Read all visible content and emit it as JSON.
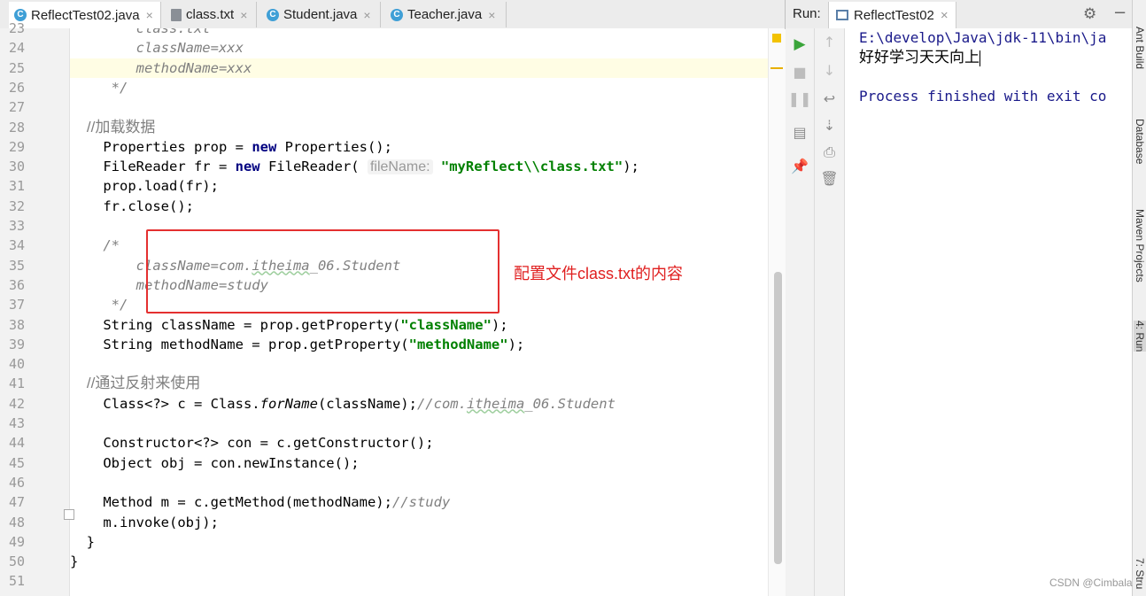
{
  "tabs": [
    {
      "label": "ReflectTest02.java",
      "icon": "java-class-icon",
      "active": true
    },
    {
      "label": "class.txt",
      "icon": "text-file-icon",
      "active": false
    },
    {
      "label": "Student.java",
      "icon": "java-class-icon",
      "active": false
    },
    {
      "label": "Teacher.java",
      "icon": "java-class-icon",
      "active": false
    }
  ],
  "tab_close_glyph": "×",
  "editor": {
    "lines": [
      {
        "n": "23",
        "text": "        class.txt"
      },
      {
        "n": "24",
        "text": "        className=xxx"
      },
      {
        "n": "25",
        "text": "        methodName=xxx"
      },
      {
        "n": "26",
        "text": "     */"
      },
      {
        "n": "27",
        "text": ""
      },
      {
        "n": "28",
        "text": "    //加载数据"
      },
      {
        "n": "29",
        "a": "    Properties prop = ",
        "b": "new",
        "c": " Properties();"
      },
      {
        "n": "30",
        "a": "    FileReader fr = ",
        "b": "new",
        "c": " FileReader( ",
        "hint": "fileName:",
        "d": " ",
        "s": "\"myReflect\\\\class.txt\"",
        "e": ");"
      },
      {
        "n": "31",
        "text": "    prop.load(fr);"
      },
      {
        "n": "32",
        "text": "    fr.close();"
      },
      {
        "n": "33",
        "text": ""
      },
      {
        "n": "34",
        "text": "    /*"
      },
      {
        "n": "35",
        "a": "        className=com.",
        "w": "itheima",
        "c": "_06.Student"
      },
      {
        "n": "36",
        "text": "        methodName=study"
      },
      {
        "n": "37",
        "text": "     */"
      },
      {
        "n": "38",
        "a": "    String className = prop.getProperty(",
        "s": "\"className\"",
        "e": ");"
      },
      {
        "n": "39",
        "a": "    String methodName = prop.getProperty(",
        "s": "\"methodName\"",
        "e": ");"
      },
      {
        "n": "40",
        "text": ""
      },
      {
        "n": "41",
        "text": "    //通过反射来使用"
      },
      {
        "n": "42",
        "a": "    Class<?> c = Class.",
        "i": "forName",
        "c": "(className);",
        "cm1": "//com.",
        "w": "itheima",
        "cm2": "_06.Student"
      },
      {
        "n": "43",
        "text": ""
      },
      {
        "n": "44",
        "text": "    Constructor<?> con = c.getConstructor();"
      },
      {
        "n": "45",
        "text": "    Object obj = con.newInstance();"
      },
      {
        "n": "46",
        "text": ""
      },
      {
        "n": "47",
        "a": "    Method m = c.getMethod(methodName);",
        "cm1": "//study"
      },
      {
        "n": "48",
        "text": "    m.invoke(obj);"
      },
      {
        "n": "49",
        "text": "  }"
      },
      {
        "n": "50",
        "text": "}"
      },
      {
        "n": "51",
        "text": ""
      }
    ],
    "annotation": "配置文件class.txt的内容"
  },
  "run": {
    "label": "Run:",
    "tab_label": "ReflectTest02",
    "console": [
      "E:\\develop\\Java\\jdk-11\\bin\\ja",
      "好好学习天天向上",
      "",
      "Process finished with exit co"
    ]
  },
  "right_strip": {
    "items": [
      "Ant Build",
      "Database",
      "Maven Projects",
      "4: Run",
      "7: Stru"
    ]
  },
  "watermark": "CSDN @Cimbala"
}
